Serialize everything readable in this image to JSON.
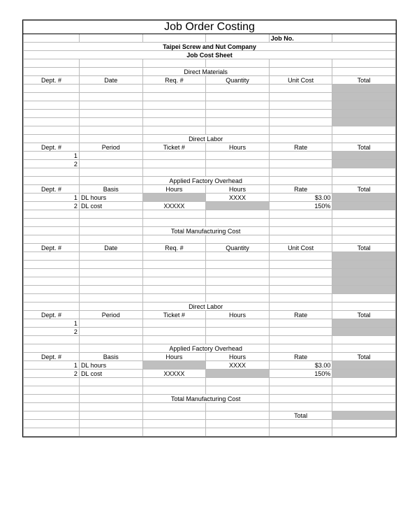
{
  "title": "Job Order Costing",
  "job_no_label": "Job No.",
  "company": "Taipei Screw and Nut Company",
  "sheet_name": "Job Cost Sheet",
  "sections": {
    "direct_materials": {
      "title": "Direct Materials",
      "headers": [
        "Dept. #",
        "Date",
        "Req. #",
        "Quantity",
        "Unit Cost",
        "Total"
      ]
    },
    "direct_labor": {
      "title": "Direct Labor",
      "headers": [
        "Dept. #",
        "Period",
        "Ticket #",
        "Hours",
        "Rate",
        "Total"
      ],
      "rows": [
        "1",
        "2"
      ]
    },
    "overhead": {
      "title": "Applied Factory Overhead",
      "headers": [
        "Dept. #",
        "Basis",
        "Hours",
        "Hours",
        "Rate",
        "Total"
      ],
      "rows": [
        {
          "dept": "1",
          "basis": "DL hours",
          "col3": "",
          "col4": "XXXX",
          "rate": "$3.00"
        },
        {
          "dept": "2",
          "basis": "DL cost",
          "col3": "XXXXX",
          "col4": "",
          "rate": "150%"
        }
      ]
    },
    "total_mfg": "Total Manufacturing Cost",
    "bottom_total": "Total"
  }
}
